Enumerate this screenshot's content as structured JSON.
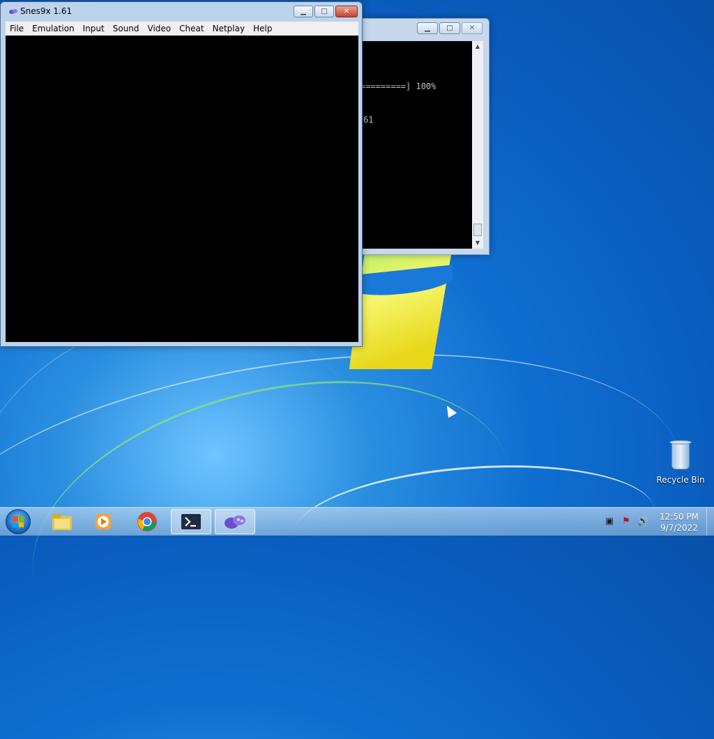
{
  "desktop": {
    "icons": [
      {
        "label": "Recycle Bin",
        "icon": "recycle-bin-icon"
      }
    ]
  },
  "console_window": {
    "lines": [
      "=========] 100%",
      "61"
    ],
    "buttons": {
      "minimize": "▁",
      "maximize": "□",
      "close": "✕"
    }
  },
  "snes_window": {
    "title": "Snes9x 1.61",
    "icon": "snes-controller-icon",
    "menu": [
      "File",
      "Emulation",
      "Input",
      "Sound",
      "Video",
      "Cheat",
      "Netplay",
      "Help"
    ],
    "buttons": {
      "minimize": "▁",
      "maximize": "□",
      "close": "✕"
    }
  },
  "taskbar": {
    "start": "windows-start-icon",
    "pinned": [
      {
        "icon": "file-explorer-icon",
        "active": false
      },
      {
        "icon": "media-player-icon",
        "active": false
      },
      {
        "icon": "chrome-icon",
        "active": false
      },
      {
        "icon": "powershell-icon",
        "active": true
      },
      {
        "icon": "snes9x-icon",
        "active": true
      }
    ],
    "tray": [
      "network-icon",
      "action-center-icon",
      "volume-icon"
    ],
    "clock": {
      "time": "12:50 PM",
      "date": "9/7/2022"
    }
  },
  "colors": {
    "accent": "#1b6bc2",
    "close_red": "#c6422c",
    "desktop_blue": "#0a5ec0"
  }
}
